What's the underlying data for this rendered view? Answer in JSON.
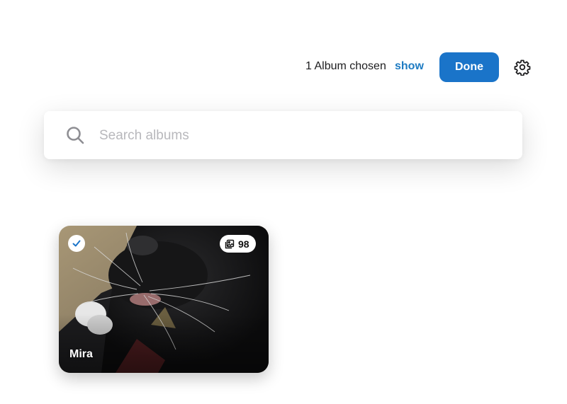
{
  "header": {
    "chosen_text": "1 Album chosen",
    "show_label": "show",
    "done_label": "Done",
    "settings_icon": "gear-icon"
  },
  "search": {
    "placeholder": "Search albums",
    "value": "",
    "icon": "search-icon"
  },
  "albums": [
    {
      "name": "Mira",
      "count": "98",
      "selected": true,
      "count_icon": "photos-icon",
      "check_icon": "checkmark-icon"
    }
  ],
  "colors": {
    "accent": "#1a74c9",
    "link": "#1e7bc2",
    "placeholder": "#b8b8bc"
  }
}
